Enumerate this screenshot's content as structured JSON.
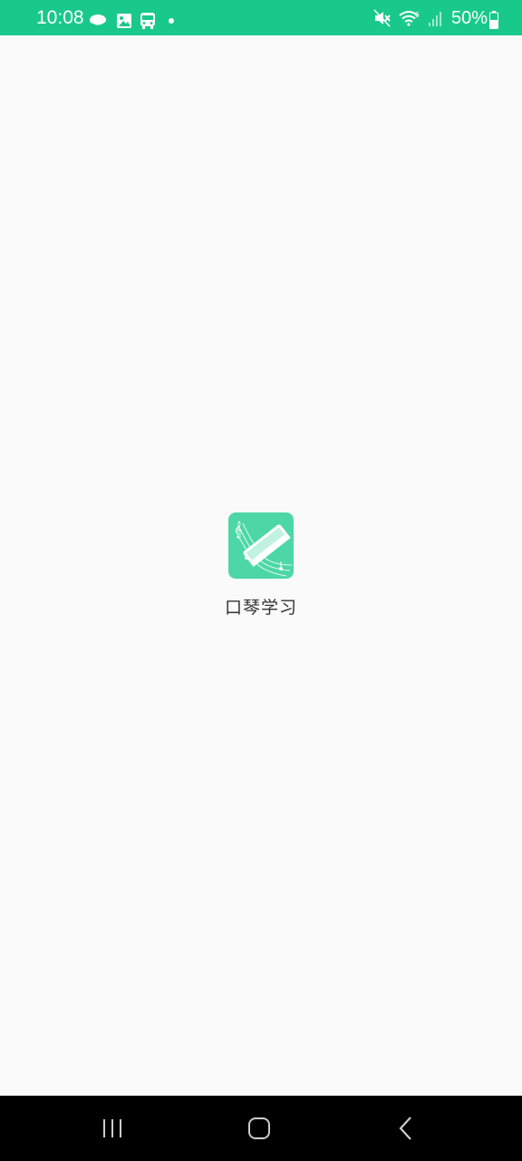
{
  "status_bar": {
    "time": "10:08",
    "battery_percent": "50%",
    "left_icons": [
      "weather-icon",
      "image-icon",
      "bus-icon",
      "dot-icon"
    ],
    "right_icons": [
      "mute-icon",
      "wifi-icon",
      "signal-icon",
      "battery-icon"
    ],
    "background_color": "#19c98b"
  },
  "splash": {
    "app_icon": "harmonica-icon",
    "app_name": "口琴学习",
    "icon_color": "#4dd7a7"
  },
  "nav_bar": {
    "buttons": [
      "recents-icon",
      "home-icon",
      "back-icon"
    ]
  }
}
